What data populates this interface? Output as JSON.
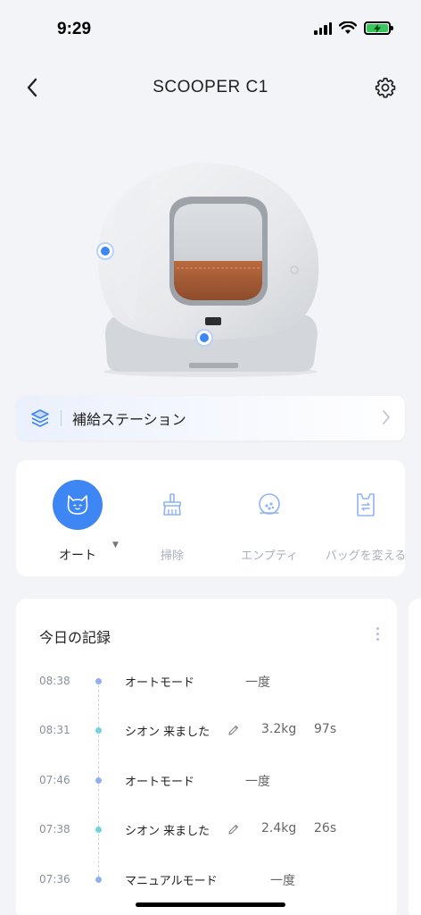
{
  "status_bar": {
    "time": "9:29"
  },
  "nav": {
    "title": "SCOOPER C1"
  },
  "station": {
    "label": "補給ステーション"
  },
  "modes": [
    {
      "label": "オート",
      "active": true
    },
    {
      "label": "掃除"
    },
    {
      "label": "エンプティ"
    },
    {
      "label": "バッグを変える"
    }
  ],
  "records": {
    "title": "今日の記録",
    "items": [
      {
        "time": "08:38",
        "event": "オートモード",
        "detail": "一度"
      },
      {
        "time": "08:31",
        "event": "シオン 来ました",
        "weight": "3.2kg",
        "duration": "97s"
      },
      {
        "time": "07:46",
        "event": "オートモード",
        "detail": "一度"
      },
      {
        "time": "07:38",
        "event": "シオン 来ました",
        "weight": "2.4kg",
        "duration": "26s"
      },
      {
        "time": "07:36",
        "event": "マニュアルモード",
        "detail": "一度"
      }
    ]
  },
  "colors": {
    "accent": "#3d86f3",
    "dot_mode": "#93aef0",
    "dot_visit": "#6fd3e0"
  }
}
